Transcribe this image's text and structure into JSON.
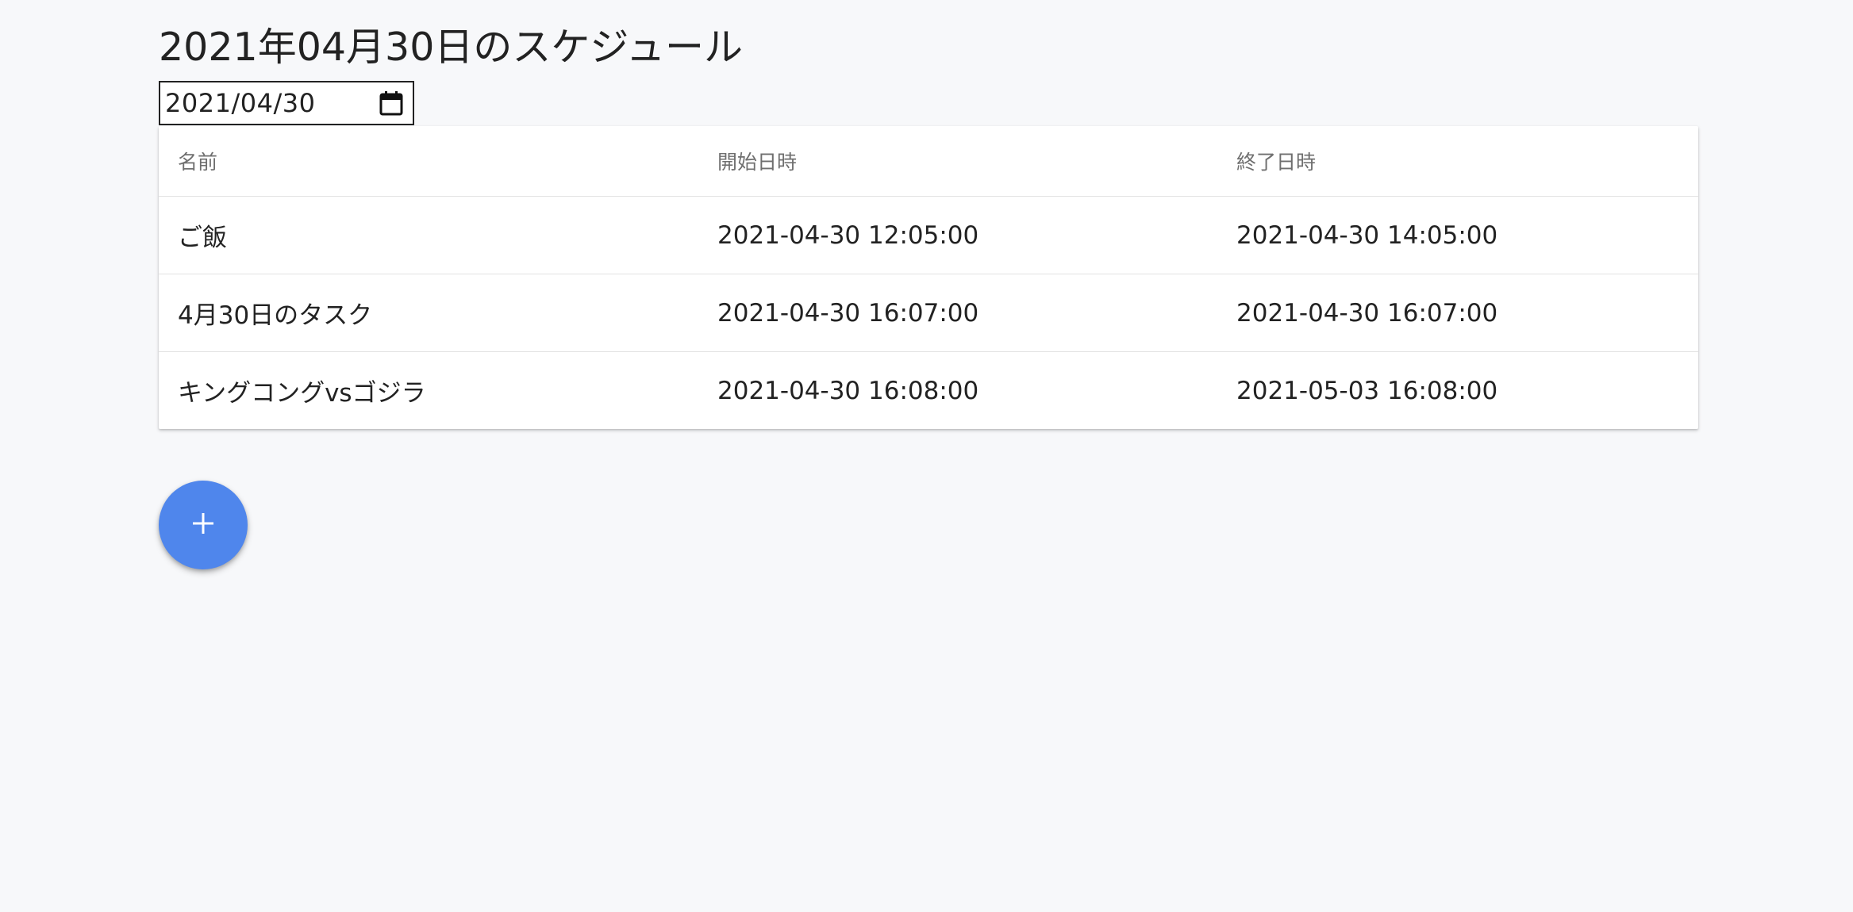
{
  "page": {
    "title": "2021年04月30日のスケジュール"
  },
  "date_picker": {
    "value": "2021/04/30",
    "icon": "calendar-icon"
  },
  "schedule_table": {
    "headers": {
      "name": "名前",
      "start": "開始日時",
      "end": "終了日時"
    },
    "rows": [
      {
        "name": "ご飯",
        "start": "2021-04-30 12:05:00",
        "end": "2021-04-30 14:05:00"
      },
      {
        "name": "4月30日のタスク",
        "start": "2021-04-30 16:07:00",
        "end": "2021-04-30 16:07:00"
      },
      {
        "name": "キングコングvsゴジラ",
        "start": "2021-04-30 16:08:00",
        "end": "2021-05-03 16:08:00"
      }
    ]
  },
  "add_button": {
    "icon": "plus-icon",
    "color": "#4f86ec"
  }
}
